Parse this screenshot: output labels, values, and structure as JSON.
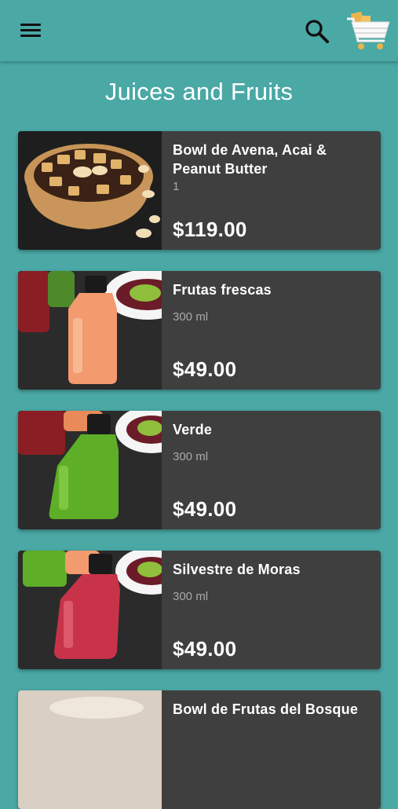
{
  "app_bar": {
    "menu_icon": "hamburger-menu-icon",
    "search_icon": "search-icon",
    "cart_icon": "shopping-cart-icon"
  },
  "page": {
    "title": "Juices and Fruits"
  },
  "colors": {
    "background": "#4aa8a5",
    "card": "#3f3f3f",
    "subtitle": "#a9a9a9"
  },
  "products": [
    {
      "name": "Bowl de Avena, Acai & Peanut Butter",
      "subtitle": "1",
      "price": "$119.00"
    },
    {
      "name": "Frutas frescas",
      "subtitle": "300 ml",
      "price": "$49.00"
    },
    {
      "name": "Verde",
      "subtitle": "300 ml",
      "price": "$49.00"
    },
    {
      "name": "Silvestre de Moras",
      "subtitle": "300 ml",
      "price": "$49.00"
    },
    {
      "name": "Bowl de Frutas del Bosque",
      "subtitle": "",
      "price": ""
    }
  ]
}
